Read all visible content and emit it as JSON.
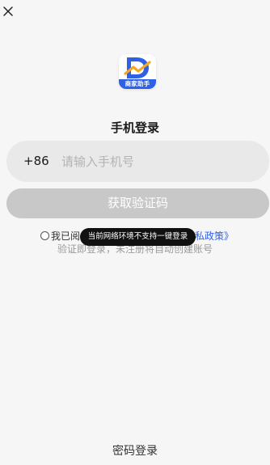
{
  "logo": {
    "band_text": "商家助手",
    "brand_color": "#2f61e6",
    "accent_color": "#f5a623"
  },
  "header": {
    "title": "手机登录"
  },
  "phone": {
    "country_code": "+86",
    "placeholder": "请输入手机号",
    "value": ""
  },
  "get_code_button": {
    "label": "获取验证码",
    "state": "disabled"
  },
  "agreement": {
    "checked": false,
    "visible_prefix": "我已阅",
    "link_text": "私政策》"
  },
  "hint": {
    "text": "验证即登录，未注册将自动创建账号"
  },
  "toast": {
    "text": "当前网络环境不支持一键登录"
  },
  "footer": {
    "password_login_label": "密码登录"
  },
  "icons": {
    "close": "close-icon",
    "radio": "radio-unchecked"
  }
}
